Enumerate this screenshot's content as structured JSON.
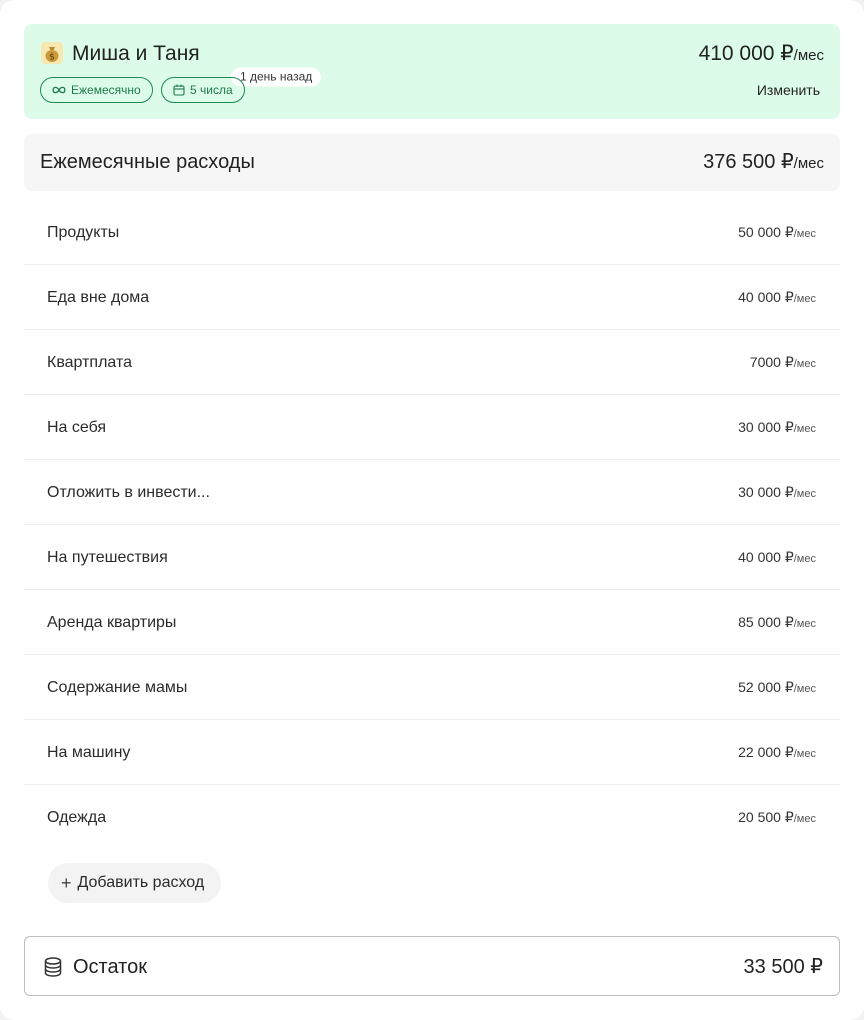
{
  "income": {
    "emoji": "💰",
    "title": "Миша и Таня",
    "ago": "1 день назад",
    "amount": "410 000 ₽",
    "amount_unit": "/мес",
    "frequency": "Ежемесячно",
    "day": "5 числа",
    "edit_label": "Изменить",
    "bg_color": "#dcfce9",
    "accent_color": "#1f8a55"
  },
  "expenses": {
    "label": "Ежемесячные расходы",
    "total": "376 500 ₽",
    "total_unit": "/мес",
    "items": [
      {
        "name": "Продукты",
        "value": "50 000 ₽",
        "unit": "/мес"
      },
      {
        "name": "Еда вне дома",
        "value": "40 000 ₽",
        "unit": "/мес"
      },
      {
        "name": "Квартплата",
        "value": "7000 ₽",
        "unit": "/мес"
      },
      {
        "name": "На себя",
        "value": "30 000 ₽",
        "unit": "/мес"
      },
      {
        "name": "Отложить в инвести...",
        "value": "30 000 ₽",
        "unit": "/мес"
      },
      {
        "name": "На путешествия",
        "value": "40 000 ₽",
        "unit": "/мес"
      },
      {
        "name": "Аренда квартиры",
        "value": "85 000 ₽",
        "unit": "/мес"
      },
      {
        "name": "Содержание мамы",
        "value": "52 000 ₽",
        "unit": "/мес"
      },
      {
        "name": "На машину",
        "value": "22 000 ₽",
        "unit": "/мес"
      },
      {
        "name": "Одежда",
        "value": "20 500 ₽",
        "unit": "/мес"
      }
    ],
    "add_label": "Добавить расход"
  },
  "remainder": {
    "label": "Остаток",
    "value": "33 500 ₽"
  }
}
